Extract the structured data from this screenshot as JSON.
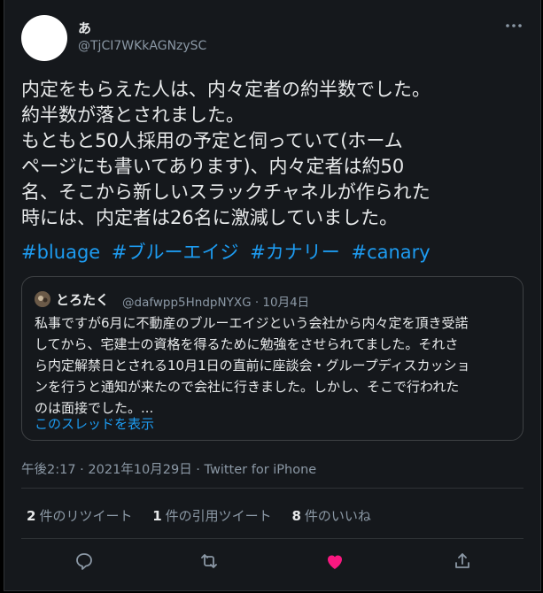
{
  "tweet": {
    "display_name": "あ",
    "handle": "@TjCI7WKkAGNzySC",
    "body_lines": [
      "内定をもらえた人は、内々定者の約半数でした。",
      "約半数が落とされました。",
      "もともと50人採用の予定と伺っていて(ホーム",
      "ページにも書いてあります)、内々定者は約50",
      "名、そこから新しいスラックチャネルが作られた",
      "時には、内定者は26名に激減していました。"
    ],
    "hashtags": [
      "#bluage",
      "#ブルーエイジ",
      "#カナリー",
      "#canary"
    ],
    "meta": "午後2:17 · 2021年10月29日 · Twitter for iPhone"
  },
  "quote": {
    "display_name": "とろたく",
    "handle_date": "@dafwpp5HndpNYXG · 10月4日",
    "lines": [
      "私事ですが6月に不動産のブルーエイジという会社から内々定を頂き受諾",
      "してから、宅建士の資格を得るために勉強をさせられてました。それさ",
      "ら内定解禁日とされる10月1日の直前に座談会・グループディスカッショ",
      "ンを行うと通知が来たので会社に行きました。しかし、そこで行われた",
      "のは面接でした。..."
    ],
    "thread_link": "このスレッドを表示"
  },
  "stats": [
    {
      "count": "2",
      "label": "件のリツイート"
    },
    {
      "count": "1",
      "label": "件の引用ツイート"
    },
    {
      "count": "8",
      "label": "件のいいね"
    }
  ],
  "colors": {
    "background": "#15181c",
    "link": "#1d9bf0",
    "like": "#f91880",
    "muted": "#8b98a5"
  }
}
